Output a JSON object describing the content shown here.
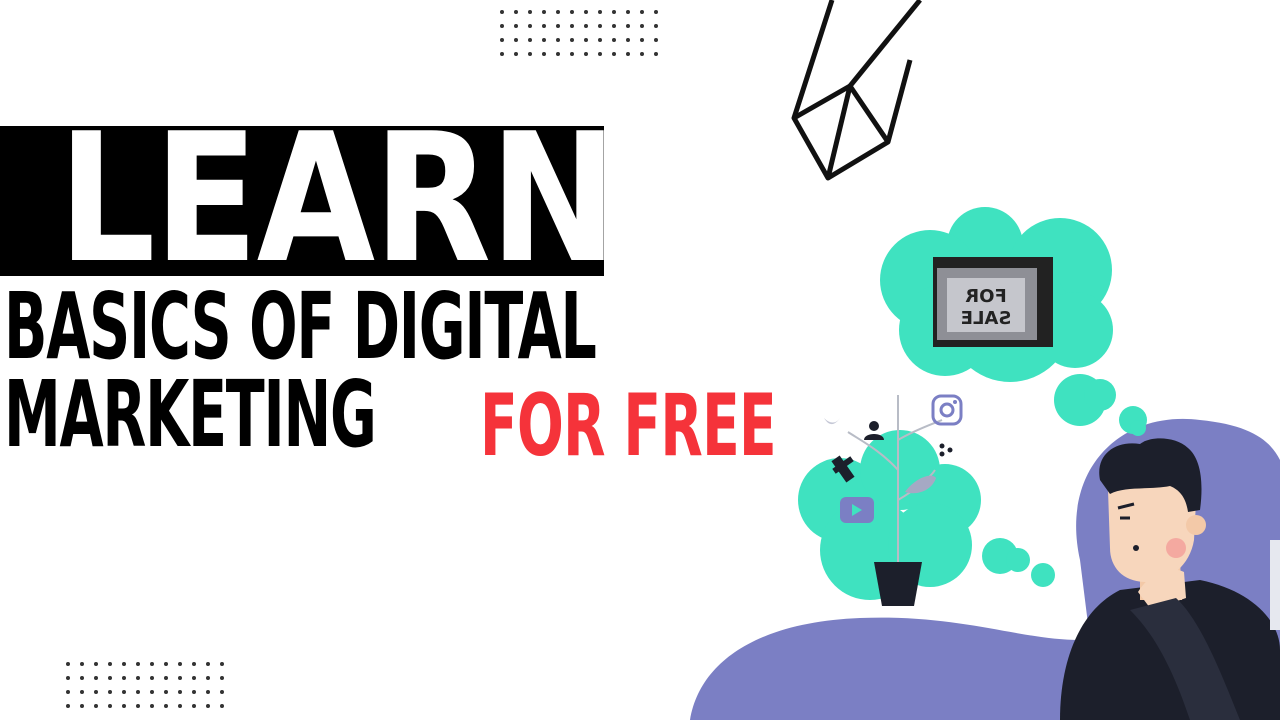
{
  "headline": {
    "learn": "LEARN",
    "line1": "BASICS OF DIGITAL",
    "line2": "MARKETING",
    "for_free": "FOR FREE"
  },
  "colors": {
    "banner": "#000000",
    "accent_red": "#f5333a",
    "cloud_teal": "#3fe2c0",
    "blob_purple": "#7b7fc4",
    "character_dark": "#1c1f2b"
  },
  "sign": {
    "line1": "FOR",
    "line2": "SALE"
  },
  "icons": [
    "instagram-icon",
    "youtube-icon",
    "facebook-icon",
    "twitter-icon",
    "user-icon",
    "share-icon"
  ]
}
